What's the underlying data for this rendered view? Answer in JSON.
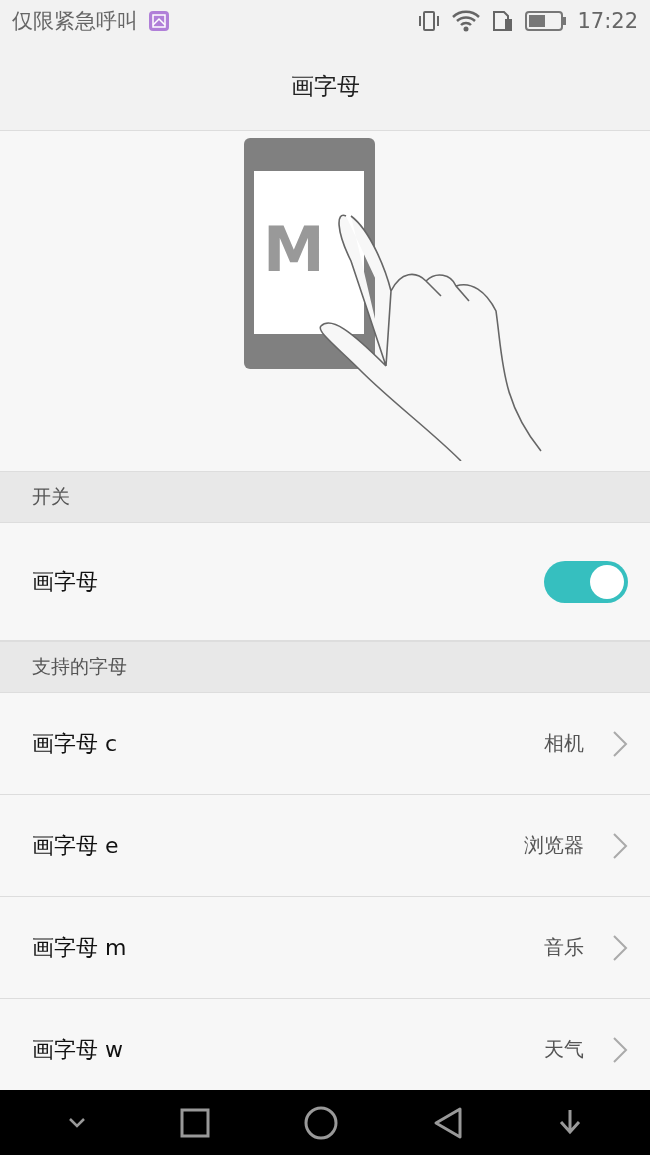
{
  "status_bar": {
    "carrier": "仅限紧急呼叫",
    "time": "17:22"
  },
  "title": "画字母",
  "illustration": {
    "letter": "M"
  },
  "sections": [
    {
      "header": "开关",
      "rows": [
        {
          "kind": "toggle",
          "label": "画字母",
          "on": true
        }
      ]
    },
    {
      "header": "支持的字母",
      "rows": [
        {
          "kind": "link",
          "label": "画字母 c",
          "value": "相机"
        },
        {
          "kind": "link",
          "label": "画字母 e",
          "value": "浏览器"
        },
        {
          "kind": "link",
          "label": "画字母 m",
          "value": "音乐"
        },
        {
          "kind": "link",
          "label": "画字母 w",
          "value": "天气"
        }
      ]
    }
  ]
}
